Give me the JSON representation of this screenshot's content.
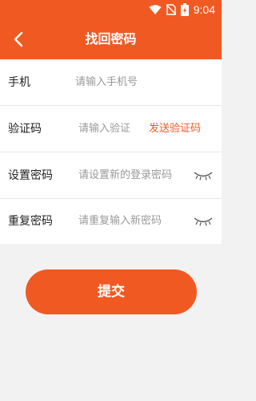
{
  "status_bar": {
    "time": "9:04"
  },
  "header": {
    "title": "找回密码"
  },
  "form": {
    "phone": {
      "label": "手机",
      "placeholder": "请输入手机号"
    },
    "code": {
      "label": "验证码",
      "placeholder": "请输入验证",
      "send_button": "发送验证码"
    },
    "new_password": {
      "label": "设置密码",
      "placeholder": "请设置新的登录密码"
    },
    "confirm_password": {
      "label": "重复密码",
      "placeholder": "请重复输入新密码"
    }
  },
  "submit_label": "提交",
  "colors": {
    "accent": "#f05a22",
    "background": "#f2f2f2"
  }
}
